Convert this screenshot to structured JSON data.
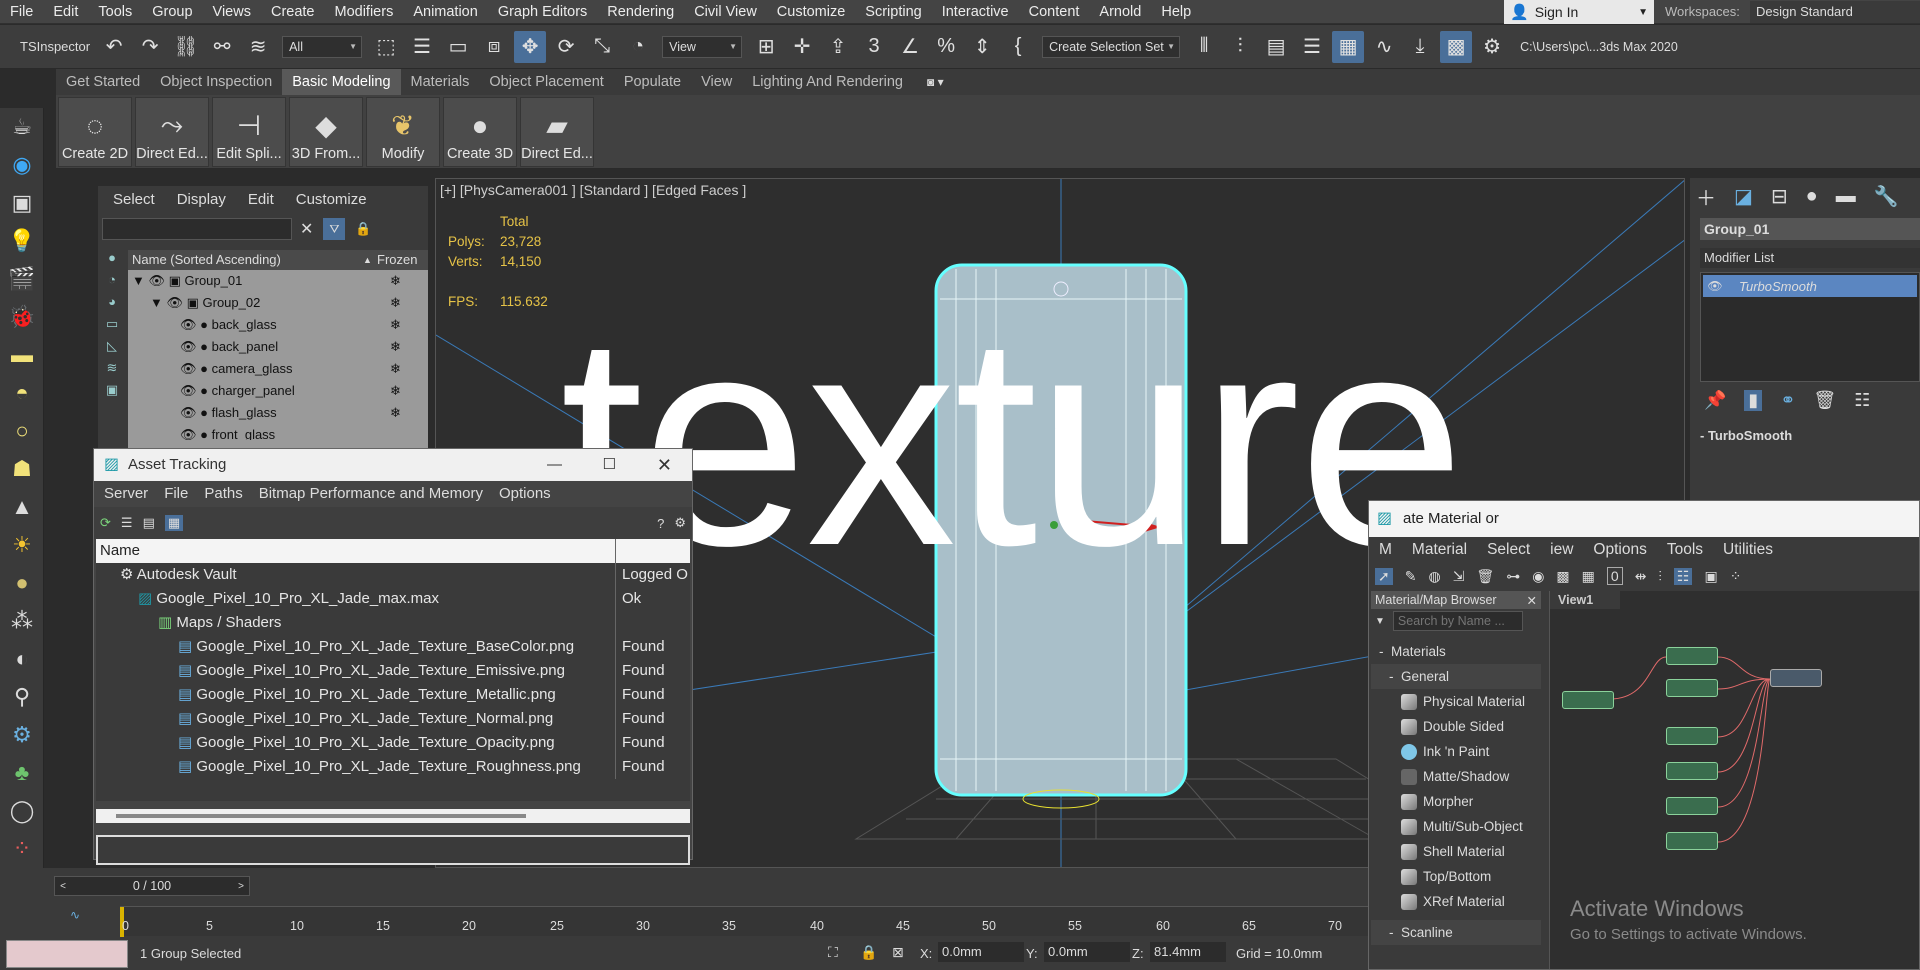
{
  "menubar": {
    "items": [
      "File",
      "Edit",
      "Tools",
      "Group",
      "Views",
      "Create",
      "Modifiers",
      "Animation",
      "Graph Editors",
      "Rendering",
      "Civil View",
      "Customize",
      "Scripting",
      "Interactive",
      "Content",
      "Arnold",
      "Help"
    ],
    "signin": "Sign In",
    "workspaces_label": "Workspaces:",
    "workspace": "Design Standard"
  },
  "toolbar": {
    "tsinspector": "TSInspector",
    "filter": "All",
    "view": "View",
    "selection_set": "Create Selection Set",
    "path": "C:\\Users\\pc\\...3ds Max 2020"
  },
  "ribbon": {
    "tabs": [
      "Get Started",
      "Object Inspection",
      "Basic Modeling",
      "Materials",
      "Object Placement",
      "Populate",
      "View",
      "Lighting And Rendering"
    ],
    "buttons": [
      "Create 2D",
      "Direct Ed...",
      "Edit Spli...",
      "3D From...",
      "Modify",
      "Create 3D",
      "Direct Ed..."
    ]
  },
  "scene_explorer": {
    "tabs": [
      "Select",
      "Display",
      "Edit",
      "Customize"
    ],
    "col_name": "Name (Sorted Ascending)",
    "col_frozen": "Frozen",
    "rows": [
      "Group_01",
      "Group_02",
      "back_glass",
      "back_panel",
      "camera_glass",
      "charger_panel",
      "flash_glass",
      "front_glass"
    ]
  },
  "viewport": {
    "label": "[+] [PhysCamera001 ] [Standard ] [Edged Faces ]",
    "total": "Total",
    "polys_label": "Polys:",
    "polys": "23,728",
    "verts_label": "Verts:",
    "verts": "14,150",
    "fps_label": "FPS:",
    "fps": "115.632",
    "watermark": "texture"
  },
  "command_panel": {
    "object_name": "Group_01",
    "modifier_list": "Modifier List",
    "modifier": "TurboSmooth",
    "rollout": "TurboSmooth"
  },
  "asset_tracking": {
    "title": "Asset Tracking",
    "menu": [
      "Server",
      "File",
      "Paths",
      "Bitmap Performance and Memory",
      "Options"
    ],
    "col_name": "Name",
    "rows": [
      {
        "name": "Autodesk Vault",
        "status": "Logged O"
      },
      {
        "name": "Google_Pixel_10_Pro_XL_Jade_max.max",
        "status": "Ok"
      },
      {
        "name": "Maps / Shaders",
        "status": ""
      },
      {
        "name": "Google_Pixel_10_Pro_XL_Jade_Texture_BaseColor.png",
        "status": "Found"
      },
      {
        "name": "Google_Pixel_10_Pro_XL_Jade_Texture_Emissive.png",
        "status": "Found"
      },
      {
        "name": "Google_Pixel_10_Pro_XL_Jade_Texture_Metallic.png",
        "status": "Found"
      },
      {
        "name": "Google_Pixel_10_Pro_XL_Jade_Texture_Normal.png",
        "status": "Found"
      },
      {
        "name": "Google_Pixel_10_Pro_XL_Jade_Texture_Opacity.png",
        "status": "Found"
      },
      {
        "name": "Google_Pixel_10_Pro_XL_Jade_Texture_Roughness.png",
        "status": "Found"
      }
    ]
  },
  "slate": {
    "title": "ate Material    or",
    "menu": [
      "M",
      "Material",
      "Select",
      "iew",
      "Options",
      "Tools",
      "Utilities"
    ],
    "browser_title": "Material/Map Browser",
    "search_placeholder": "Search by Name ...",
    "materials": "Materials",
    "general": "General",
    "items": [
      "Physical Material",
      "Double Sided",
      "Ink 'n Paint",
      "Matte/Shadow",
      "Morpher",
      "Multi/Sub-Object",
      "Shell Material",
      "Top/Bottom",
      "XRef Material"
    ],
    "scanline": "Scanline",
    "view_tab": "View1",
    "activate_title": "Activate Windows",
    "activate_sub": "Go to Settings to activate Windows."
  },
  "timeline": {
    "frame": "0 / 100",
    "ticks": [
      "0",
      "5",
      "10",
      "15",
      "20",
      "25",
      "30",
      "35",
      "40",
      "45",
      "50",
      "55",
      "60",
      "65",
      "70"
    ]
  },
  "status": {
    "selected": "1 Group Selected",
    "x_label": "X:",
    "x": "0.0mm",
    "y_label": "Y:",
    "y": "0.0mm",
    "z_label": "Z:",
    "z": "81.4mm",
    "grid": "Grid = 10.0mm"
  }
}
